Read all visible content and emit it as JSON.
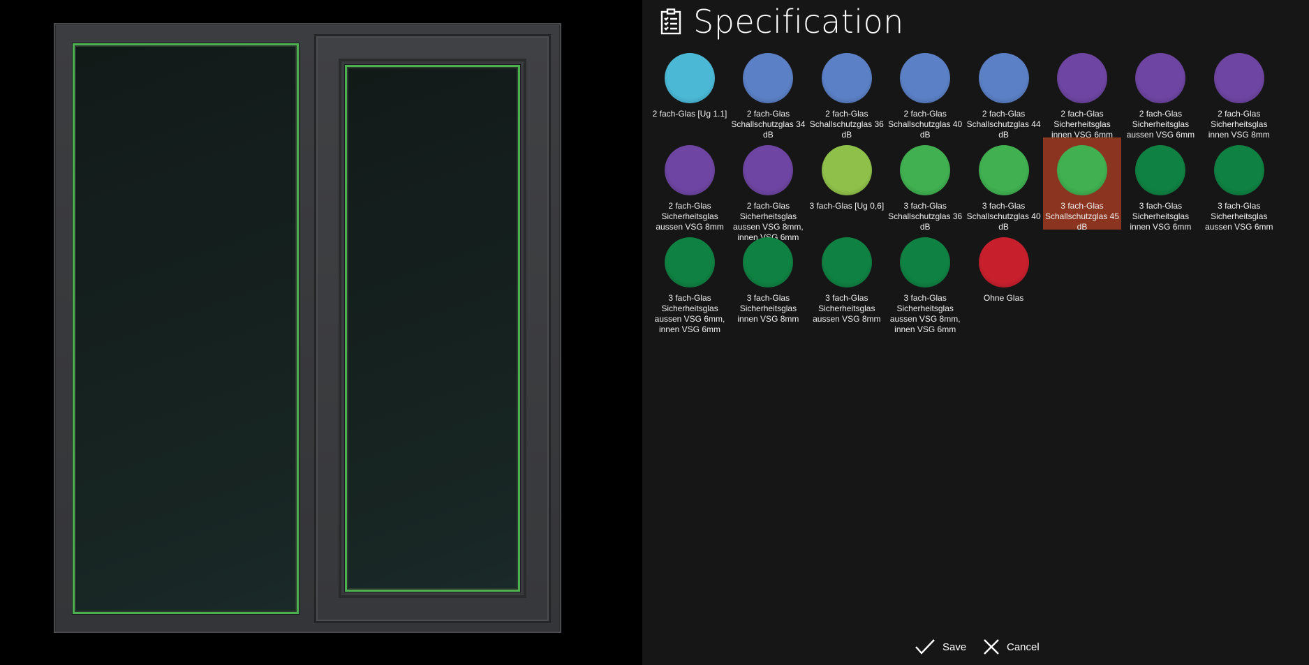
{
  "title": "Specification",
  "selected_index": 13,
  "colors": {
    "background": "#161616",
    "selected": "#8b3520",
    "glass_border": "#4caf50"
  },
  "options": [
    {
      "label": "2 fach-Glas [Ug 1.1]",
      "color": "#4bb9d6"
    },
    {
      "label": "2 fach-Glas Schallschutzglas 34 dB",
      "color": "#5b80c6"
    },
    {
      "label": "2 fach-Glas Schallschutzglas 36 dB",
      "color": "#5b80c6"
    },
    {
      "label": "2 fach-Glas Schallschutzglas 40 dB",
      "color": "#5b80c6"
    },
    {
      "label": "2 fach-Glas Schallschutzglas 44 dB",
      "color": "#5b80c6"
    },
    {
      "label": "2 fach-Glas Sicherheitsglas innen VSG 6mm",
      "color": "#6e45a2"
    },
    {
      "label": "2 fach-Glas Sicherheitsglas aussen VSG 6mm",
      "color": "#6e45a2"
    },
    {
      "label": "2 fach-Glas Sicherheitsglas innen VSG 8mm",
      "color": "#6e45a2"
    },
    {
      "label": "2 fach-Glas Sicherheitsglas aussen VSG 8mm",
      "color": "#6e45a2"
    },
    {
      "label": "2 fach-Glas Sicherheitsglas aussen VSG 8mm, innen VSG 6mm",
      "color": "#6e45a2"
    },
    {
      "label": "3 fach-Glas [Ug 0,6]",
      "color": "#8fc14a"
    },
    {
      "label": "3 fach-Glas Schallschutzglas 36 dB",
      "color": "#40b050"
    },
    {
      "label": "3 fach-Glas Schallschutzglas 40 dB",
      "color": "#40b050"
    },
    {
      "label": "3 fach-Glas Schallschutzglas 45 dB",
      "color": "#40b050"
    },
    {
      "label": "3 fach-Glas Sicherheitsglas innen VSG 6mm",
      "color": "#0f8142"
    },
    {
      "label": "3 fach-Glas Sicherheitsglas aussen VSG 6mm",
      "color": "#0f8142"
    },
    {
      "label": "3 fach-Glas Sicherheitsglas aussen VSG 6mm, innen VSG 6mm",
      "color": "#0f8142"
    },
    {
      "label": "3 fach-Glas Sicherheitsglas innen VSG 8mm",
      "color": "#0f8142"
    },
    {
      "label": "3 fach-Glas Sicherheitsglas aussen VSG 8mm",
      "color": "#0f8142"
    },
    {
      "label": "3 fach-Glas Sicherheitsglas aussen VSG 8mm, innen VSG 6mm",
      "color": "#0f8142"
    },
    {
      "label": "Ohne Glas",
      "color": "#c81f2d"
    }
  ],
  "actions": {
    "save": "Save",
    "cancel": "Cancel",
    "save_icon": "checkmark-icon",
    "cancel_icon": "close-icon"
  }
}
